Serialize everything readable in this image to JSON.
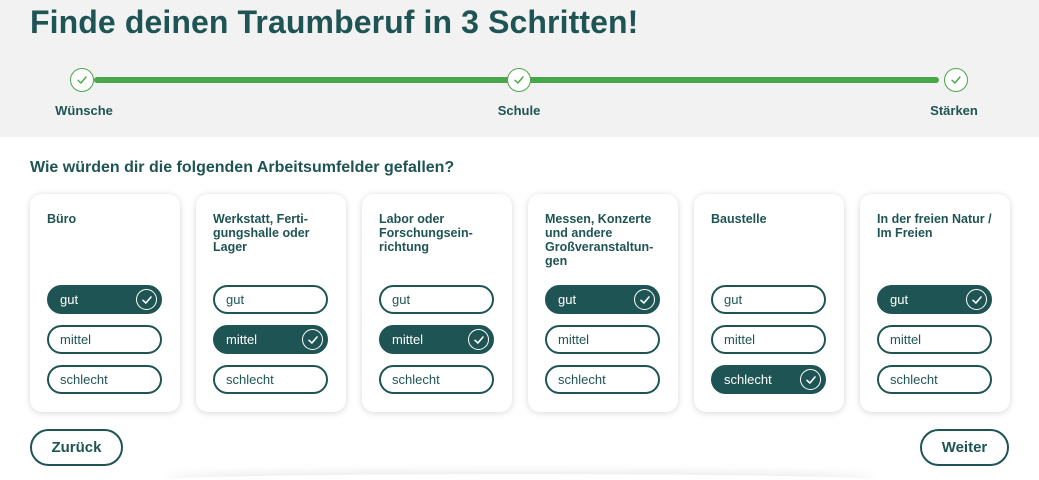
{
  "header": {
    "title": "Finde deinen Traumberuf in 3 Schritten!",
    "steps": [
      {
        "label": "Wünsche",
        "done": true
      },
      {
        "label": "Schule",
        "done": false
      },
      {
        "label": "Stärken",
        "done": false
      }
    ]
  },
  "question": "Wie würden dir die folgenden Arbeitsumfelder gefallen?",
  "options": [
    "gut",
    "mittel",
    "schlecht"
  ],
  "cards": [
    {
      "title": "Büro",
      "selected": "gut"
    },
    {
      "title": "Werkstatt, Ferti-\ngungshalle oder\nLager",
      "selected": "mittel"
    },
    {
      "title": "Labor oder\nForschungsein-\nrichtung",
      "selected": "mittel"
    },
    {
      "title": "Messen, Konzerte\nund andere\nGroßveranstaltun-\ngen",
      "selected": "gut"
    },
    {
      "title": "Baustelle",
      "selected": "schlecht"
    },
    {
      "title": "In der freien Natur /\nIm Freien",
      "selected": "gut"
    }
  ],
  "nav": {
    "back_label": "Zurück",
    "next_label": "Weiter"
  },
  "colors": {
    "primary": "#1f5454",
    "progress": "#4aa64a",
    "header_bg": "#f1f2f1"
  }
}
